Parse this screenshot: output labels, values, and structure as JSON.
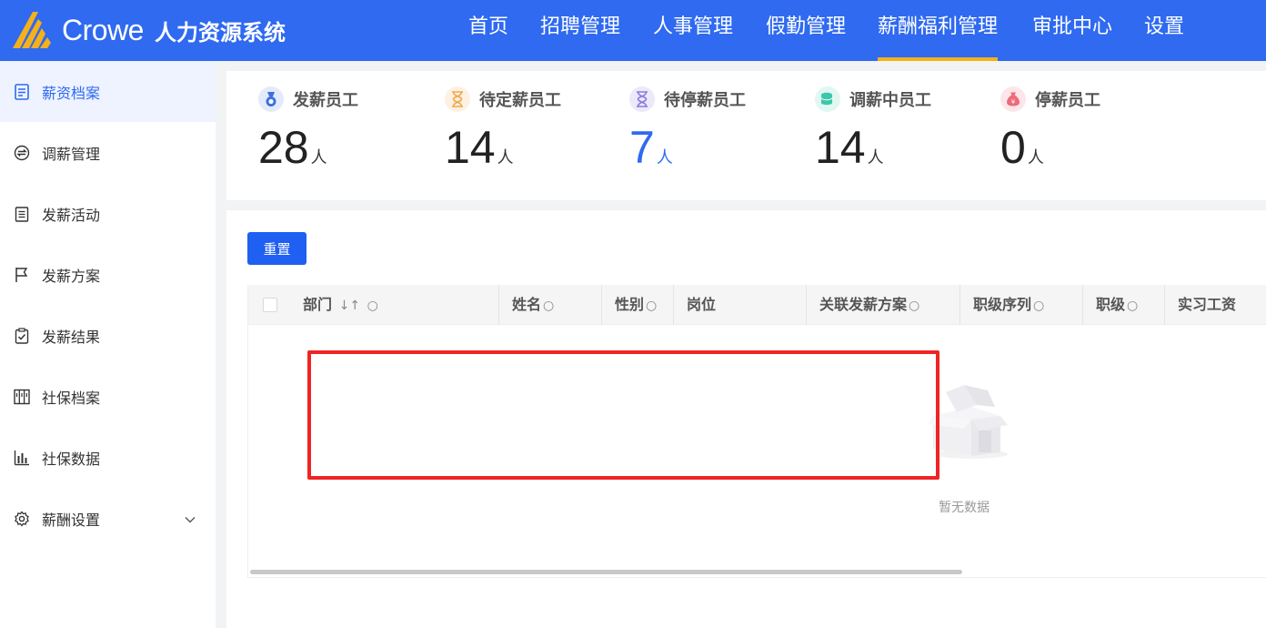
{
  "header": {
    "brand": "Crowe",
    "system_name": "人力资源系统",
    "nav": [
      {
        "label": "首页"
      },
      {
        "label": "招聘管理"
      },
      {
        "label": "人事管理"
      },
      {
        "label": "假勤管理"
      },
      {
        "label": "薪酬福利管理",
        "active": true
      },
      {
        "label": "审批中心"
      },
      {
        "label": "设置"
      }
    ],
    "accent_color": "#2f6af0",
    "active_underline_color": "#f5b01a"
  },
  "sidebar": {
    "items": [
      {
        "label": "薪资档案",
        "icon": "document-list-icon",
        "active": true
      },
      {
        "label": "调薪管理",
        "icon": "exchange-icon"
      },
      {
        "label": "发薪活动",
        "icon": "clipboard-icon"
      },
      {
        "label": "发薪方案",
        "icon": "flag-icon"
      },
      {
        "label": "发薪结果",
        "icon": "clipboard-check-icon"
      },
      {
        "label": "社保档案",
        "icon": "cabinet-icon"
      },
      {
        "label": "社保数据",
        "icon": "bar-chart-icon"
      },
      {
        "label": "薪酬设置",
        "icon": "gear-icon",
        "expandable": true
      }
    ]
  },
  "stats": [
    {
      "label": "发薪员工",
      "value": "28",
      "unit": "人",
      "icon": "medal-icon",
      "icon_color": "#3b6fe0",
      "value_color": "#222"
    },
    {
      "label": "待定薪员工",
      "value": "14",
      "unit": "人",
      "icon": "hourglass-icon",
      "icon_color": "#f0a94b",
      "value_color": "#222"
    },
    {
      "label": "待停薪员工",
      "value": "7",
      "unit": "人",
      "icon": "hourglass-icon",
      "icon_color": "#8a7be0",
      "value_color": "#2f6af0"
    },
    {
      "label": "调薪中员工",
      "value": "14",
      "unit": "人",
      "icon": "coins-icon",
      "icon_color": "#3cc7a8",
      "value_color": "#222"
    },
    {
      "label": "停薪员工",
      "value": "0",
      "unit": "人",
      "icon": "money-bag-icon",
      "icon_color": "#ee6b7a",
      "value_color": "#222"
    }
  ],
  "toolbar": {
    "reset_label": "重置"
  },
  "table": {
    "columns": [
      {
        "label": "部门",
        "sortable": true,
        "filter": true
      },
      {
        "label": "姓名",
        "filter": true
      },
      {
        "label": "性别",
        "filter": true
      },
      {
        "label": "岗位"
      },
      {
        "label": "关联发薪方案",
        "filter": true
      },
      {
        "label": "职级序列",
        "filter": true
      },
      {
        "label": "职级",
        "filter": true
      },
      {
        "label": "实习工资"
      }
    ],
    "rows": [],
    "empty_text": "暂无数据"
  }
}
